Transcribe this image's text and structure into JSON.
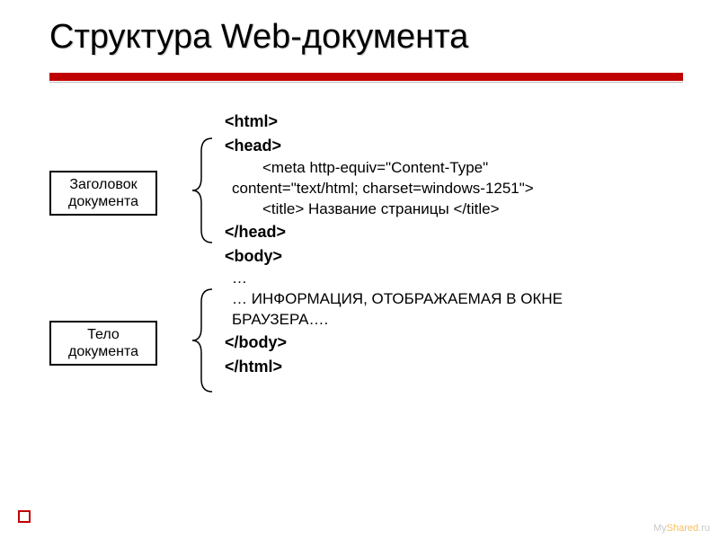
{
  "title": "Структура Web-документа",
  "labels": {
    "head": "Заголовок документа",
    "body": "Тело документа"
  },
  "code": {
    "html_open": "<html>",
    "head_open": "<head>",
    "meta_line1": "<meta http-equiv=\"Content-Type\"",
    "meta_line2": "content=\"text/html; charset=windows-1251\">",
    "title_line": "<title> Название страницы </title>",
    "head_close": "</head>",
    "body_open": "<body>",
    "dots": "…",
    "info1": "… ИНФОРМАЦИЯ, ОТОБРАЖАЕМАЯ В ОКНЕ",
    "info2": "БРАУЗЕРА….",
    "body_close": "</body>",
    "html_close": "</html>"
  },
  "watermark": {
    "p1": "My",
    "p2": "Shared",
    "p3": ".ru"
  }
}
